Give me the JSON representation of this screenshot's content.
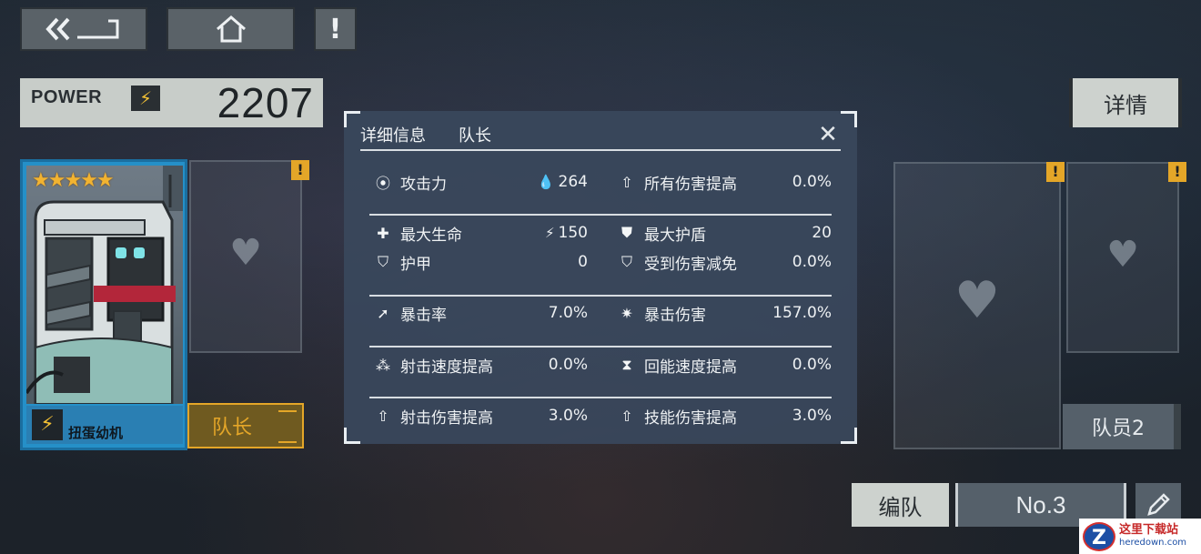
{
  "top_buttons": {
    "back_icon": "double-chevron-back-icon",
    "home_icon": "home-icon",
    "alert_icon": "exclamation-icon",
    "alert_label": "!"
  },
  "power": {
    "label": "POWER",
    "bolt": "⚡",
    "value": "2207"
  },
  "detail_button": {
    "label": "详情"
  },
  "leader": {
    "name": "扭蛋幼机",
    "stars": "★★★★★",
    "bolt": "⚡",
    "role_label": "队长"
  },
  "slots": {
    "warn": "!",
    "member2_label": "队员2",
    "card_icon": "♥"
  },
  "modal": {
    "title": "详细信息",
    "subtitle": "队长",
    "close_icon": "✕",
    "stats": [
      {
        "icon": "⦿",
        "label": "攻击力",
        "val_icon": "💧",
        "value": "264"
      },
      {
        "icon": "⇧",
        "label": "所有伤害提高",
        "value": "0.0%"
      },
      {
        "icon": "✚",
        "label": "最大生命",
        "val_icon": "⚡",
        "value": "150"
      },
      {
        "icon": "⛊",
        "label": "最大护盾",
        "value": "20"
      },
      {
        "icon": "⛉",
        "label": "护甲",
        "value": "0"
      },
      {
        "icon": "⛉",
        "label": "受到伤害减免",
        "value": "0.0%"
      },
      {
        "icon": "➚",
        "label": "暴击率",
        "value": "7.0%"
      },
      {
        "icon": "✷",
        "label": "暴击伤害",
        "value": "157.0%"
      },
      {
        "icon": "⁂",
        "label": "射击速度提高",
        "value": "0.0%"
      },
      {
        "icon": "⧗",
        "label": "回能速度提高",
        "value": "0.0%"
      },
      {
        "icon": "⇧",
        "label": "射击伤害提高",
        "value": "3.0%"
      },
      {
        "icon": "⇧",
        "label": "技能伤害提高",
        "value": "3.0%"
      }
    ]
  },
  "bottom": {
    "team_label": "编队",
    "team_no": "No.3",
    "edit_icon": "pencil-icon"
  },
  "watermark": {
    "logo": "Z",
    "cn": "这里下载站",
    "en": "heredown.com"
  },
  "colors": {
    "accent_gold": "#e4a628",
    "leader_blue": "#2590c8",
    "modal_bg": "#3a485c"
  }
}
